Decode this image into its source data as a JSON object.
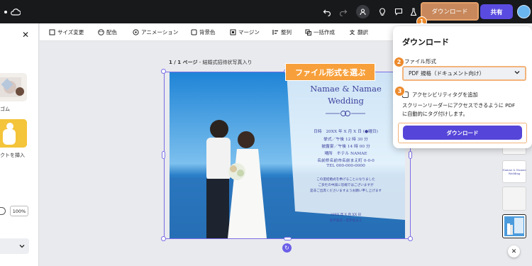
{
  "topbar": {
    "download_label": "ダウンロード",
    "share_label": "共有",
    "badge_1": "1"
  },
  "left_panel": {
    "eraser_label": "ゴム",
    "effect_label": "クトを挿入",
    "zoom_value": "100%"
  },
  "toolbar": {
    "items": [
      {
        "label": "サイズ変更",
        "icon": "resize-icon"
      },
      {
        "label": "配色",
        "icon": "palette-icon"
      },
      {
        "label": "アニメーション",
        "icon": "animation-icon"
      },
      {
        "label": "背景色",
        "icon": "square-icon"
      },
      {
        "label": "マージン",
        "icon": "margin-icon"
      },
      {
        "label": "整列",
        "icon": "align-icon"
      },
      {
        "label": "一括作成",
        "icon": "bulk-icon"
      },
      {
        "label": "翻訳",
        "icon": "translate-icon"
      }
    ]
  },
  "canvas": {
    "page_indicator": "1 / 1 ページ",
    "page_title": " - 結婚式招待状写真入り"
  },
  "invitation": {
    "names": "Namae & Namae",
    "wedding": "Wedding",
    "date_line": "日時　20XX 年 X 月 X 日 (●曜日)",
    "ceremony_line": "挙式／午後 12 時 30 分",
    "reception_line": "披露宴／午後 14 時 00 分",
    "venue_line": "場所　ホテル NAMAE",
    "address_line": "名前県名前市名前まえ町 0-0-0",
    "tel_line": "TEL 000-000-0000",
    "note_1": "この度結婚式を挙げることになりました",
    "note_2": "ご多忙の中誠に恐縮ではございますが",
    "note_3": "是非ご出席くださいますようお願い申し上げます",
    "sign_date": "20XX 年 X 月 XX 日",
    "sign_names": "名字名前・名字名まえ"
  },
  "callout": {
    "text": "ファイル形式を選ぶ"
  },
  "download_panel": {
    "title": "ダウンロード",
    "file_type_label": "ファイル形式",
    "file_type_value": "PDF 規格（ドキュメント向け）",
    "accessibility_label": "アクセシビリティタグを追加",
    "accessibility_desc_1": "スクリーンリーダーにアクセスできるように PDF",
    "accessibility_desc_2": "に自動的にタグ付けします。",
    "download_button": "ダウンロード",
    "badge_2": "2",
    "badge_3": "3"
  },
  "right_rail": {
    "thumb_text_1": "Namae & Namae",
    "thumb_text_2": "Wedding"
  },
  "colors": {
    "accent_purple": "#5545d8",
    "accent_orange": "#ed8a2c",
    "topbar_bg": "#18191b"
  }
}
